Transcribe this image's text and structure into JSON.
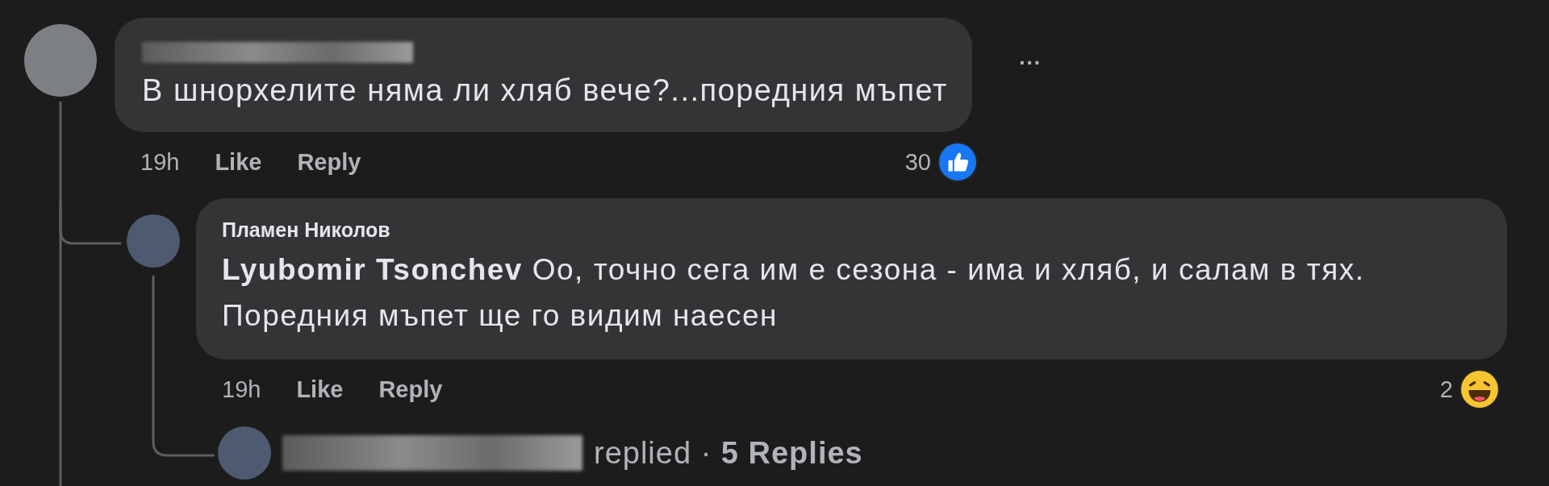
{
  "comment": {
    "text": "В шнорхелите няма ли хляб вече?...поредния мъпет",
    "menu": "···",
    "time": "19h",
    "actions": [
      "Like",
      "Reply"
    ],
    "reaction_count": "30",
    "reaction": {
      "kind": "like"
    }
  },
  "reply": {
    "author": "Пламен Николов",
    "mention": "Lyubomir Tsonchev",
    "text": "Оо, точно сега им е сезона - има и хляб, и салам в тях.\nПоредния мъпет ще го видим наесен",
    "time": "19h",
    "actions": [
      "Like",
      "Reply"
    ],
    "reaction_count": "2",
    "reaction": {
      "kind": "haha"
    }
  },
  "replies_summary": {
    "verb": "replied",
    "separator": "·",
    "count": "5 Replies"
  }
}
